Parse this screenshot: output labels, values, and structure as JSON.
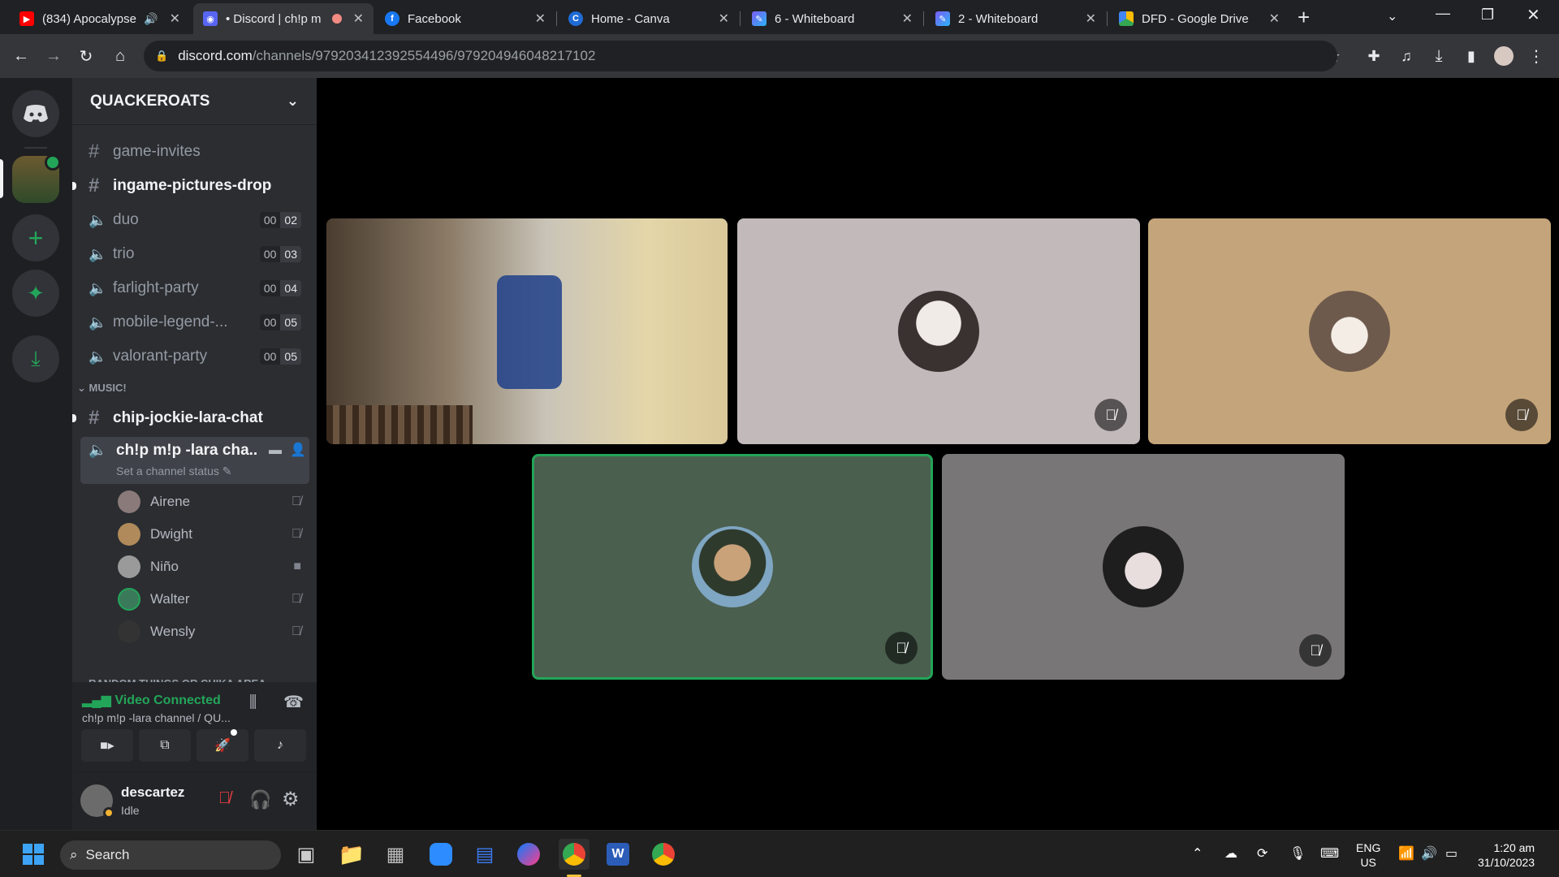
{
  "browser": {
    "tabs": [
      {
        "title": "(834) Apocalypse",
        "icon": "youtube-icon"
      },
      {
        "title": "• Discord | ch!p m",
        "icon": "discord-icon",
        "active": true
      },
      {
        "title": "Facebook",
        "icon": "facebook-icon"
      },
      {
        "title": "Home - Canva",
        "icon": "canva-icon"
      },
      {
        "title": "6 - Whiteboard",
        "icon": "whiteboard-icon"
      },
      {
        "title": "2 - Whiteboard",
        "icon": "whiteboard-icon"
      },
      {
        "title": "DFD - Google Drive",
        "icon": "drive-icon"
      }
    ],
    "url_host": "discord.com",
    "url_path": "/channels/979203412392554496/979204946048217102"
  },
  "discord": {
    "server_name": "QUACKEROATS",
    "channels": [
      {
        "type": "text",
        "name": "game-invites",
        "unread": false
      },
      {
        "type": "text",
        "name": "ingame-pictures-drop",
        "unread": true
      },
      {
        "type": "voice",
        "name": "duo",
        "count_a": "00",
        "count_b": "02"
      },
      {
        "type": "voice",
        "name": "trio",
        "count_a": "00",
        "count_b": "03"
      },
      {
        "type": "voice",
        "name": "farlight-party",
        "count_a": "00",
        "count_b": "04"
      },
      {
        "type": "voice",
        "name": "mobile-legend-...",
        "count_a": "00",
        "count_b": "05"
      },
      {
        "type": "voice",
        "name": "valorant-party",
        "count_a": "00",
        "count_b": "05"
      }
    ],
    "category_music": "MUSIC!",
    "music_text_channel": "chip-jockie-lara-chat",
    "active_voice_channel": {
      "name": "ch!p m!p -lara cha...",
      "status_placeholder": "Set a channel status"
    },
    "members": [
      {
        "name": "Airene",
        "icon": "muted-mic-icon",
        "color": "#8a7a7a"
      },
      {
        "name": "Dwight",
        "icon": "muted-mic-icon",
        "color": "#b08a5a"
      },
      {
        "name": "Niño",
        "icon": "camera-icon",
        "color": "#9a9a9a"
      },
      {
        "name": "Walter",
        "icon": "muted-mic-icon",
        "color": "#3a7a5a"
      },
      {
        "name": "Wensly",
        "icon": "muted-mic-icon",
        "color": "#333"
      }
    ],
    "next_category": "RANDOM THINGS OR CHIKA AREA",
    "connection": {
      "status": "Video Connected",
      "detail": "ch!p m!p -lara channel / QU..."
    },
    "user": {
      "name": "descartez",
      "status": "Idle"
    }
  },
  "video_tiles": [
    {
      "kind": "camera",
      "bg": "#6b5a48"
    },
    {
      "kind": "avatar",
      "bg": "#c2b9ba",
      "avatar_color": "#3a3230",
      "muted": true
    },
    {
      "kind": "avatar",
      "bg": "#c4a47a",
      "avatar_color": "#8a7060",
      "muted": true
    },
    {
      "kind": "avatar",
      "bg": "#4a5f4e",
      "avatar_color": "#4d6b7a",
      "muted": true,
      "speaking": true
    },
    {
      "kind": "avatar",
      "bg": "#787677",
      "avatar_color": "#2a2a2a",
      "muted": true
    }
  ],
  "taskbar": {
    "search_placeholder": "Search",
    "lang_top": "ENG",
    "lang_bottom": "US",
    "time": "1:20 am",
    "date": "31/10/2023"
  }
}
